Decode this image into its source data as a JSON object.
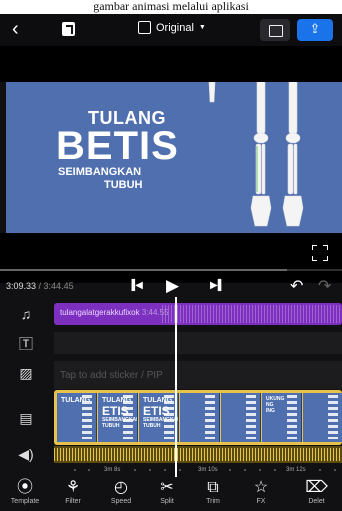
{
  "caption": "gambar animasi melalui aplikasi",
  "topbar": {
    "back_icon": "chevron-left-icon",
    "ratio_label": "Original",
    "save_icon": "save-icon",
    "export_icon": "export-icon",
    "accent": "#1a73e8"
  },
  "preview": {
    "line1": "TULANG",
    "line2": "BETIS",
    "line3": "SEIMBANGKAN",
    "line4": "TUBUH",
    "bg_color": "#4f6fae"
  },
  "player": {
    "current_time": "3:09.33",
    "separator": " / ",
    "total_time": "3:44.45",
    "progress": 0.84
  },
  "timeline": {
    "audio_label": "tulangalatgerakkufixok",
    "audio_duration": "3:44.55",
    "sticker_hint": "Tap to add sticker / PIP",
    "thumbs": [
      {
        "small": "TULANG",
        "big": "",
        "sub": ""
      },
      {
        "small": "TULANG",
        "big": "ETIS",
        "sub": "SEIMBANGKAN\nTUBUH"
      },
      {
        "small": "TULANG",
        "big": "ETIS",
        "sub": "SEIMBANGKAN\nTUBUH"
      },
      {
        "small": "",
        "big": "",
        "sub": ""
      },
      {
        "small": "",
        "big": "",
        "sub": ""
      },
      {
        "small": "",
        "big": "",
        "sub": "UKUNG\nNG\nING"
      },
      {
        "small": "",
        "big": "",
        "sub": ""
      }
    ],
    "ruler": [
      "3m 8s",
      "3m 10s",
      "3m 12s"
    ]
  },
  "toolbar": {
    "items": [
      {
        "label": "Template",
        "icon": "template-icon",
        "glyph": "⦿"
      },
      {
        "label": "Filter",
        "icon": "filter-icon",
        "glyph": "⚘"
      },
      {
        "label": "Speed",
        "icon": "speed-icon",
        "glyph": "◴"
      },
      {
        "label": "Split",
        "icon": "split-icon",
        "glyph": "✂"
      },
      {
        "label": "Trim",
        "icon": "trim-icon",
        "glyph": "⧉"
      },
      {
        "label": "FX",
        "icon": "fx-icon",
        "glyph": "☆"
      },
      {
        "label": "Delet",
        "icon": "trash-icon",
        "glyph": "⌦"
      }
    ]
  }
}
